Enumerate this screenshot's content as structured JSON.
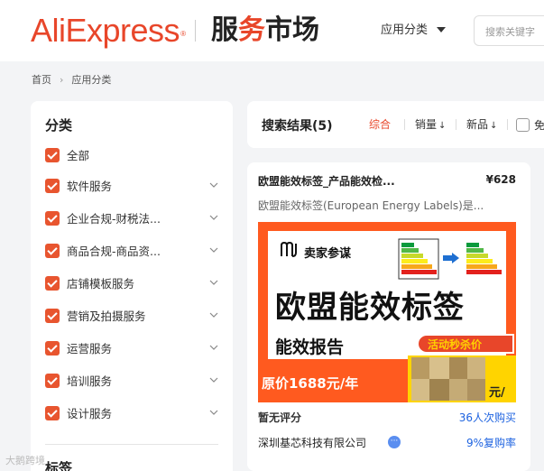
{
  "header": {
    "logo": "AliExpress",
    "logo_reg": "®",
    "market_title_a": "服",
    "market_title_o": "务",
    "market_title_b": "市场",
    "nav_category": "应用分类",
    "search_placeholder": "搜索关键字"
  },
  "breadcrumb": {
    "home": "首页",
    "current": "应用分类"
  },
  "sidebar": {
    "title": "分类",
    "items": [
      {
        "label": "全部",
        "checked": true,
        "expandable": false
      },
      {
        "label": "软件服务",
        "checked": true,
        "expandable": true
      },
      {
        "label": "企业合规-财税法...",
        "checked": true,
        "expandable": true
      },
      {
        "label": "商品合规-商品资...",
        "checked": true,
        "expandable": true
      },
      {
        "label": "店铺模板服务",
        "checked": true,
        "expandable": true
      },
      {
        "label": "营销及拍摄服务",
        "checked": true,
        "expandable": true
      },
      {
        "label": "运营服务",
        "checked": true,
        "expandable": true
      },
      {
        "label": "培训服务",
        "checked": true,
        "expandable": true
      },
      {
        "label": "设计服务",
        "checked": true,
        "expandable": true
      }
    ],
    "section2_title": "标签"
  },
  "results": {
    "title": "搜索结果(5)",
    "sort": {
      "default": "综合",
      "sales": "销量",
      "newest": "新品",
      "free": "免"
    },
    "sort_arrow": "↓"
  },
  "product": {
    "title": "欧盟能效标签_产品能效检...",
    "price": "¥628",
    "description": "欧盟能效标签(European Energy Labels)是...",
    "banner": {
      "brand": "卖家参谋",
      "headline": "欧盟能效标签",
      "subheadline": "能效报告",
      "promo": "活动秒杀价",
      "original_price": "原价1688元/年",
      "per_year": "元/年"
    },
    "rating": "暂无评分",
    "buyers": "36人次购买",
    "company": "深圳基芯科技有限公司",
    "verified_glyph": "···",
    "repurchase": "9%复购率"
  },
  "watermark": "大鹅跨境",
  "colors": {
    "accent": "#e8462a",
    "link": "#1e63e0",
    "checkbox": "#e8552f"
  }
}
